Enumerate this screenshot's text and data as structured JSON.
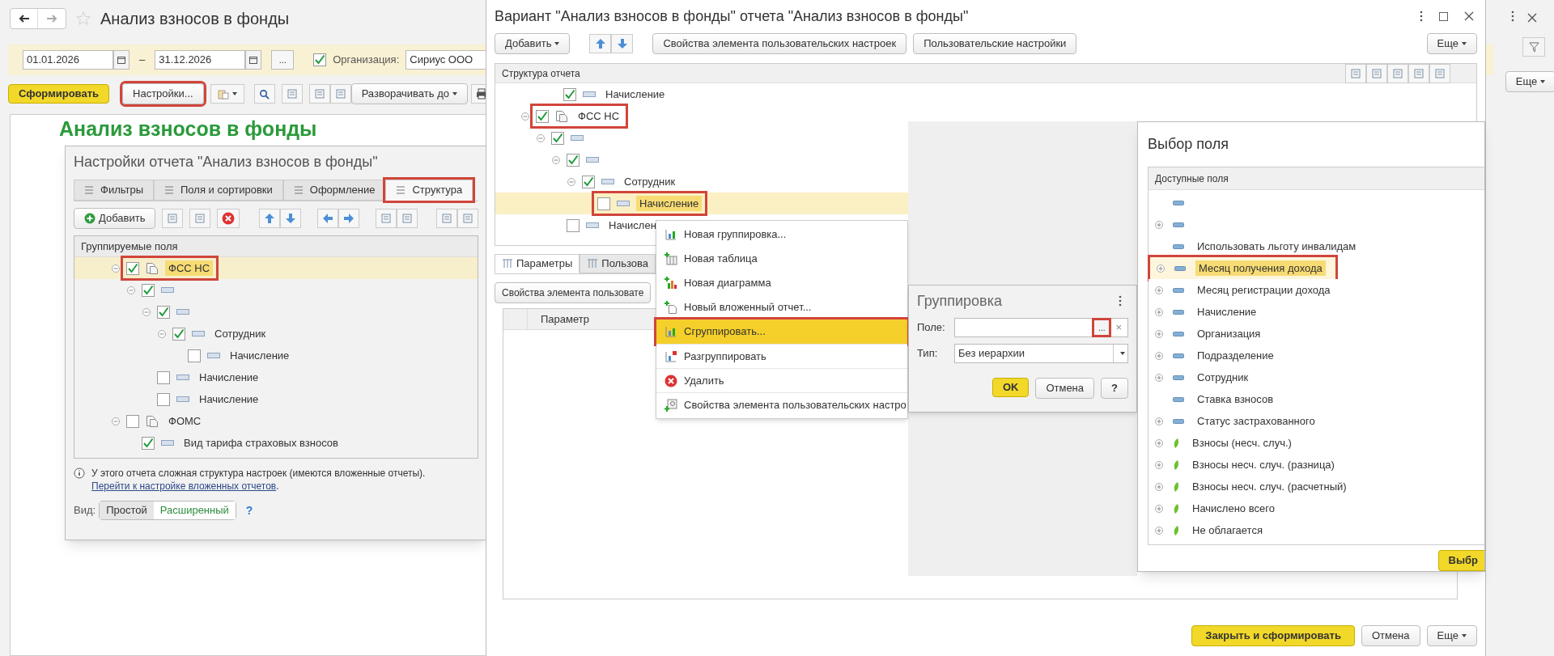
{
  "main": {
    "title": "Анализ взносов в фонды",
    "filters": {
      "date_from": "01.01.2026",
      "dash": "–",
      "date_to": "31.12.2026",
      "more": "...",
      "org_checked": true,
      "org_label": "Организация:",
      "org_value": "Сириус ООО"
    },
    "toolbar": {
      "generate": "Сформировать",
      "settings": {
        "label": "Настройки...",
        "annotated": true
      },
      "expand": "Разворачивать до"
    },
    "report_title": "Анализ взносов в фонды",
    "right_edge": {
      "more": "Еще"
    }
  },
  "settings": {
    "title": "Настройки отчета \"Анализ взносов в фонды\"",
    "tabs": [
      {
        "label": "Фильтры",
        "selected": false,
        "annotated": false
      },
      {
        "label": "Поля и сортировки",
        "selected": false,
        "annotated": false
      },
      {
        "label": "Оформление",
        "selected": false,
        "annotated": false
      },
      {
        "label": "Структура",
        "selected": true,
        "annotated": true
      }
    ],
    "add": "Добавить",
    "tree_header": "Группируемые поля",
    "tree": [
      {
        "kind": "report",
        "label": "ФСС НС",
        "checked": true,
        "selected": true,
        "annotated": true,
        "children": [
          {
            "kind": "field",
            "checked": true,
            "selected": false,
            "annotated": false,
            "children": [
              {
                "kind": "field",
                "checked": true,
                "selected": false,
                "annotated": false,
                "children": [
                  {
                    "kind": "field",
                    "label": "Сотрудник",
                    "checked": true,
                    "selected": false,
                    "annotated": false,
                    "children": [
                      {
                        "kind": "field",
                        "label": "Начисление",
                        "checked": false,
                        "selected": false,
                        "annotated": false
                      }
                    ]
                  }
                ]
              },
              {
                "kind": "field",
                "label": "Начисление",
                "checked": false,
                "selected": false,
                "annotated": false
              },
              {
                "kind": "field",
                "label": "Начисление",
                "checked": false,
                "selected": false,
                "annotated": false
              }
            ]
          }
        ]
      },
      {
        "kind": "report",
        "label": "ФОМС",
        "checked": false,
        "selected": false,
        "annotated": false,
        "children": [
          {
            "kind": "field",
            "label": "Вид тарифа страховых взносов",
            "checked": true,
            "selected": false,
            "annotated": false
          }
        ]
      }
    ],
    "info": "У этого отчета сложная структура настроек (имеются вложенные отчеты).",
    "link": "Перейти к настройке вложенных отчетов",
    "link_suffix": ".",
    "view_label": "Вид:",
    "view_options": [
      {
        "label": "Простой",
        "selected": false
      },
      {
        "label": "Расширенный",
        "selected": true
      }
    ],
    "help": "?"
  },
  "variant": {
    "title": "Вариант \"Анализ взносов в фонды\" отчета \"Анализ взносов в фонды\"",
    "toolbar": {
      "add": "Добавить",
      "properties": "Свойства элемента пользовательских настроек",
      "user_settings": "Пользовательские настройки",
      "more": "Еще"
    },
    "structure_header": "Структура отчета",
    "previous_tail": [
      {
        "label": "Начисление",
        "checked": true
      }
    ],
    "tree": [
      {
        "kind": "report",
        "label": "ФСС НС",
        "checked": true,
        "selected": false,
        "annotated": true,
        "children": [
          {
            "kind": "field",
            "checked": true,
            "selected": false,
            "annotated": false,
            "children": [
              {
                "kind": "field",
                "checked": true,
                "selected": false,
                "annotated": false,
                "children": [
                  {
                    "kind": "field",
                    "label": "Сотрудник",
                    "checked": true,
                    "selected": false,
                    "annotated": false,
                    "children": [
                      {
                        "kind": "field",
                        "label": "Начисление",
                        "checked": false,
                        "selected": true,
                        "annotated": true
                      }
                    ]
                  }
                ]
              },
              {
                "kind": "field",
                "label": "Начислен",
                "checked": false,
                "selected": false,
                "annotated": false
              }
            ]
          }
        ]
      }
    ],
    "bottom_tabs": [
      {
        "label": "Параметры",
        "selected": true
      },
      {
        "label": "Пользова",
        "selected": false
      }
    ],
    "properties_button": "Свойства элемента пользовате",
    "table_header": "Параметр",
    "footer": {
      "close": "Закрыть и сформировать",
      "cancel": "Отмена",
      "more": "Еще"
    }
  },
  "context_menu": [
    {
      "kind": "group",
      "label": "Новая группировка...",
      "selected": false,
      "annotated": false
    },
    {
      "kind": "table",
      "label": "Новая таблица",
      "selected": false,
      "annotated": false
    },
    {
      "kind": "chart",
      "label": "Новая диаграмма",
      "selected": false,
      "annotated": false
    },
    {
      "kind": "nested",
      "label": "Новый вложенный отчет...",
      "selected": false,
      "annotated": false
    },
    {
      "kind": "group_by",
      "label": "Сгруппировать...",
      "selected": true,
      "annotated": true
    },
    {
      "kind": "ungroup",
      "label": "Разгруппировать",
      "selected": false,
      "annotated": false
    },
    {
      "kind": "delete",
      "label": "Удалить",
      "selected": false,
      "annotated": false
    },
    {
      "kind": "properties",
      "label": "Свойства элемента пользовательских настро",
      "selected": false,
      "annotated": false
    }
  ],
  "group_dialog": {
    "title": "Группировка",
    "field_label": "Поле:",
    "choose": {
      "label": "...",
      "annotated": true
    },
    "clear": "×",
    "type_label": "Тип:",
    "type_value": "Без иерархии",
    "ok": "OK",
    "cancel": "Отмена",
    "help": "?"
  },
  "field_chooser": {
    "title": "Выбор поля",
    "header": "Доступные поля",
    "items": [
      {
        "kind": "dimension",
        "expandable": false,
        "selected": false,
        "annotated": false
      },
      {
        "kind": "dimension",
        "expandable": true,
        "selected": false,
        "annotated": false
      },
      {
        "kind": "dimension",
        "label": "Использовать льготу инвалидам",
        "expandable": false,
        "selected": false,
        "annotated": false
      },
      {
        "kind": "dimension",
        "label": "Месяц получения дохода",
        "expandable": true,
        "selected": true,
        "annotated": true
      },
      {
        "kind": "dimension",
        "label": "Месяц регистрации дохода",
        "expandable": true,
        "selected": false,
        "annotated": false
      },
      {
        "kind": "dimension",
        "label": "Начисление",
        "expandable": true,
        "selected": false,
        "annotated": false
      },
      {
        "kind": "dimension",
        "label": "Организация",
        "expandable": true,
        "selected": false,
        "annotated": false
      },
      {
        "kind": "dimension",
        "label": "Подразделение",
        "expandable": true,
        "selected": false,
        "annotated": false
      },
      {
        "kind": "dimension",
        "label": "Сотрудник",
        "expandable": true,
        "selected": false,
        "annotated": false
      },
      {
        "kind": "dimension",
        "label": "Ставка взносов",
        "expandable": false,
        "selected": false,
        "annotated": false
      },
      {
        "kind": "dimension",
        "label": "Статус застрахованного",
        "expandable": true,
        "selected": false,
        "annotated": false
      },
      {
        "kind": "resource",
        "label": "Взносы (несч. случ.)",
        "expandable": true,
        "selected": false,
        "annotated": false
      },
      {
        "kind": "resource",
        "label": "Взносы несч. случ. (разница)",
        "expandable": true,
        "selected": false,
        "annotated": false
      },
      {
        "kind": "resource",
        "label": "Взносы несч. случ. (расчетный)",
        "expandable": true,
        "selected": false,
        "annotated": false
      },
      {
        "kind": "resource",
        "label": "Начислено всего",
        "expandable": true,
        "selected": false,
        "annotated": false
      },
      {
        "kind": "resource",
        "label": "Не облагается",
        "expandable": true,
        "selected": false,
        "annotated": false
      }
    ],
    "select": "Выбр"
  }
}
